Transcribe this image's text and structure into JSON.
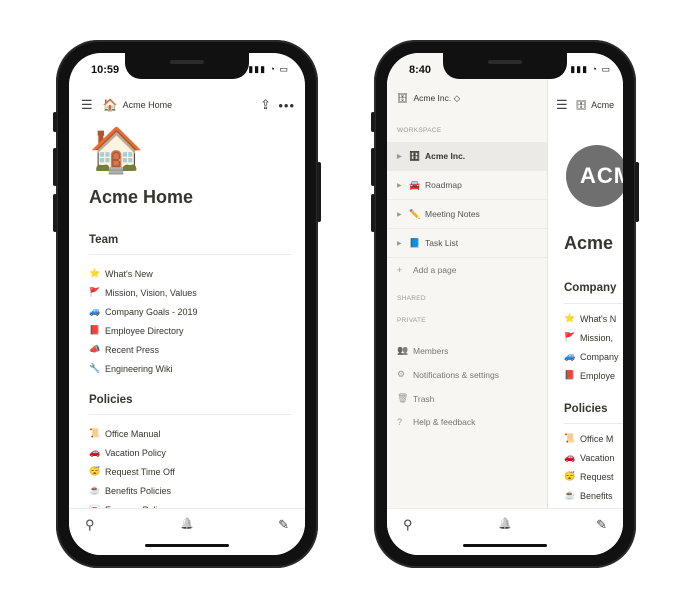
{
  "phone_left": {
    "status": {
      "time": "10:59",
      "icons": "▮▮▮ ◔ ▭"
    },
    "topbar": {
      "menu_icon": "☰",
      "crumb_emoji": "🏠",
      "crumb_title": "Acme Home",
      "share_icon": "⇪",
      "more_icon": "•••"
    },
    "page": {
      "icon": "🏠",
      "title": "Acme Home"
    },
    "sections": [
      {
        "title": "Team",
        "items": [
          {
            "icon": "⭐",
            "label": "What's New"
          },
          {
            "icon": "🚩",
            "label": "Mission, Vision, Values"
          },
          {
            "icon": "🚙",
            "label": "Company Goals - 2019"
          },
          {
            "icon": "📕",
            "label": "Employee Directory"
          },
          {
            "icon": "📣",
            "label": "Recent Press"
          },
          {
            "icon": "🔧",
            "label": "Engineering Wiki"
          }
        ]
      },
      {
        "title": "Policies",
        "items": [
          {
            "icon": "📜",
            "label": "Office Manual"
          },
          {
            "icon": "🚗",
            "label": "Vacation Policy"
          },
          {
            "icon": "😴",
            "label": "Request Time Off"
          },
          {
            "icon": "☕",
            "label": "Benefits Policies"
          },
          {
            "icon": "💌",
            "label": "Expense Policy"
          }
        ]
      }
    ],
    "bottombar": {
      "search_icon": "⚲",
      "bell_icon": "🔔",
      "compose_icon": "✎"
    }
  },
  "phone_right": {
    "status": {
      "time": "8:40",
      "icons": "▮▮▮ ◔ ▭"
    },
    "sidebar": {
      "workspace_name": "Acme Inc. ◇",
      "workspace_logo": "🗄",
      "label_workspace": "WORKSPACE",
      "items": [
        {
          "icon": "🗄",
          "label": "Acme Inc."
        },
        {
          "icon": "🚘",
          "label": "Roadmap"
        },
        {
          "icon": "✏️",
          "label": "Meeting Notes"
        },
        {
          "icon": "📘",
          "label": "Task List"
        }
      ],
      "add_page": "Add a page",
      "add_icon": "+",
      "label_shared": "SHARED",
      "label_private": "PRIVATE",
      "actions": [
        {
          "icon": "👥",
          "label": "Members"
        },
        {
          "icon": "⚙",
          "label": "Notifications & settings"
        },
        {
          "icon": "🗑",
          "label": "Trash"
        },
        {
          "icon": "?",
          "label": "Help & feedback"
        }
      ]
    },
    "peek": {
      "menu_icon": "☰",
      "crumb_logo": "🗄",
      "crumb_title": "Acme",
      "logo_text": "ACM",
      "title": "Acme",
      "section1": "Company",
      "items1": [
        {
          "icon": "⭐",
          "label": "What's N"
        },
        {
          "icon": "🚩",
          "label": "Mission,"
        },
        {
          "icon": "🚙",
          "label": "Company"
        },
        {
          "icon": "📕",
          "label": "Employe"
        }
      ],
      "section2": "Policies",
      "items2": [
        {
          "icon": "📜",
          "label": "Office M"
        },
        {
          "icon": "🚗",
          "label": "Vacation"
        },
        {
          "icon": "😴",
          "label": "Request"
        },
        {
          "icon": "☕",
          "label": "Benefits"
        }
      ]
    },
    "bottombar": {
      "search_icon": "⚲",
      "bell_icon": "🔔",
      "compose_icon": "✎"
    }
  }
}
